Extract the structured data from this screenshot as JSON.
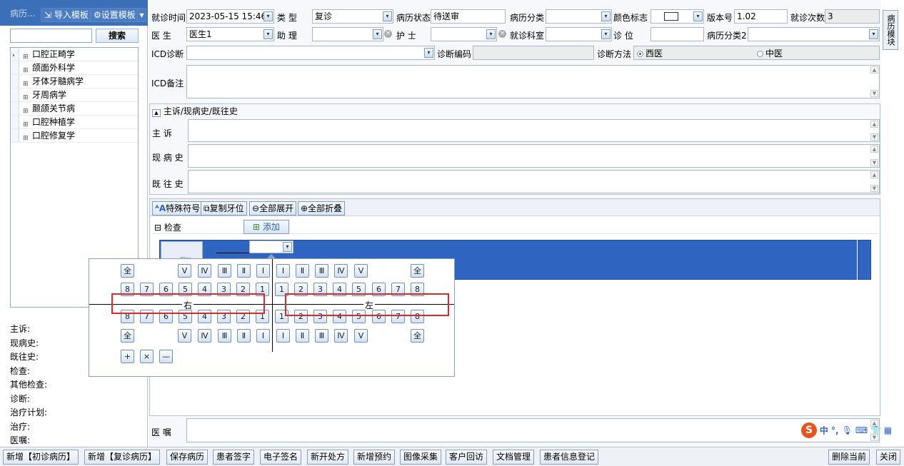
{
  "left": {
    "title": "病历...",
    "import_btn": "导入模板",
    "setting_btn": "设置模板",
    "search_btn": "搜索",
    "tree": [
      "口腔正畸学",
      "颌面外科学",
      "牙体牙髓病学",
      "牙周病学",
      "颞颌关节病",
      "口腔种植学",
      "口腔修复学"
    ],
    "summary": [
      "主诉:",
      "现病史:",
      "既往史:",
      "检查:",
      "其他检查:",
      "诊断:",
      "治疗计划:",
      "治疗:",
      "医嘱:"
    ]
  },
  "form": {
    "visit_time_label": "就诊时间",
    "visit_time": "2023-05-15 15:46",
    "type_label": "类  型",
    "type": "复诊",
    "status_label": "病历状态",
    "status": "待送审",
    "category_label": "病历分类",
    "category": "",
    "color_label": "颜色标志",
    "version_label": "版本号",
    "version": "1.02",
    "visits_label": "就诊次数",
    "visits": "3",
    "doctor_label": "医  生",
    "doctor": "医生1",
    "assistant_label": "助  理",
    "assistant": "",
    "nurse_label": "护  士",
    "nurse": "",
    "dept_label": "就诊科室",
    "dept": "",
    "chair_label": "诊  位",
    "chair": "",
    "category2_label": "病历分类2",
    "category2": "",
    "icd_label": "ICD诊断",
    "icd": "",
    "diag_code_label": "诊断编码",
    "diag_code": "",
    "diag_method_label": "诊断方法",
    "western": "西医",
    "chinese": "中医",
    "icd_note_label": "ICD备注"
  },
  "complaint": {
    "header": "主诉/现病史/既往史",
    "chief": "主  诉",
    "present": "现 病 史",
    "past": "既 往 史"
  },
  "exam": {
    "tools": [
      "特殊符号",
      "复制牙位",
      "全部展开",
      "全部折叠"
    ],
    "header": "检查",
    "add": "添加",
    "thumb": "图标"
  },
  "dental": {
    "all": "全",
    "roman_left": [
      "Ⅴ",
      "Ⅳ",
      "Ⅲ",
      "Ⅱ",
      "Ⅰ"
    ],
    "roman_right": [
      "Ⅰ",
      "Ⅱ",
      "Ⅲ",
      "Ⅳ",
      "Ⅴ"
    ],
    "num_left": [
      "8",
      "7",
      "6",
      "5",
      "4",
      "3",
      "2",
      "1"
    ],
    "num_right": [
      "1",
      "2",
      "3",
      "4",
      "5",
      "6",
      "7",
      "8"
    ],
    "right_label": "右",
    "left_label": "左",
    "ops": [
      "+",
      "×",
      "—"
    ]
  },
  "advice_label": "医  嘱",
  "side_tab": "病历模块",
  "bottom": {
    "left": [
      "新增【初诊病历】",
      "新增【复诊病历】",
      "保存病历",
      "患者签字",
      "电子签名",
      "新开处方",
      "新增预约",
      "图像采集",
      "客户回访",
      "文档管理",
      "患者信息登记"
    ],
    "delete": "删除当前",
    "close": "关闭"
  },
  "ime": {
    "text": "中 °, ",
    "logo": "S"
  }
}
